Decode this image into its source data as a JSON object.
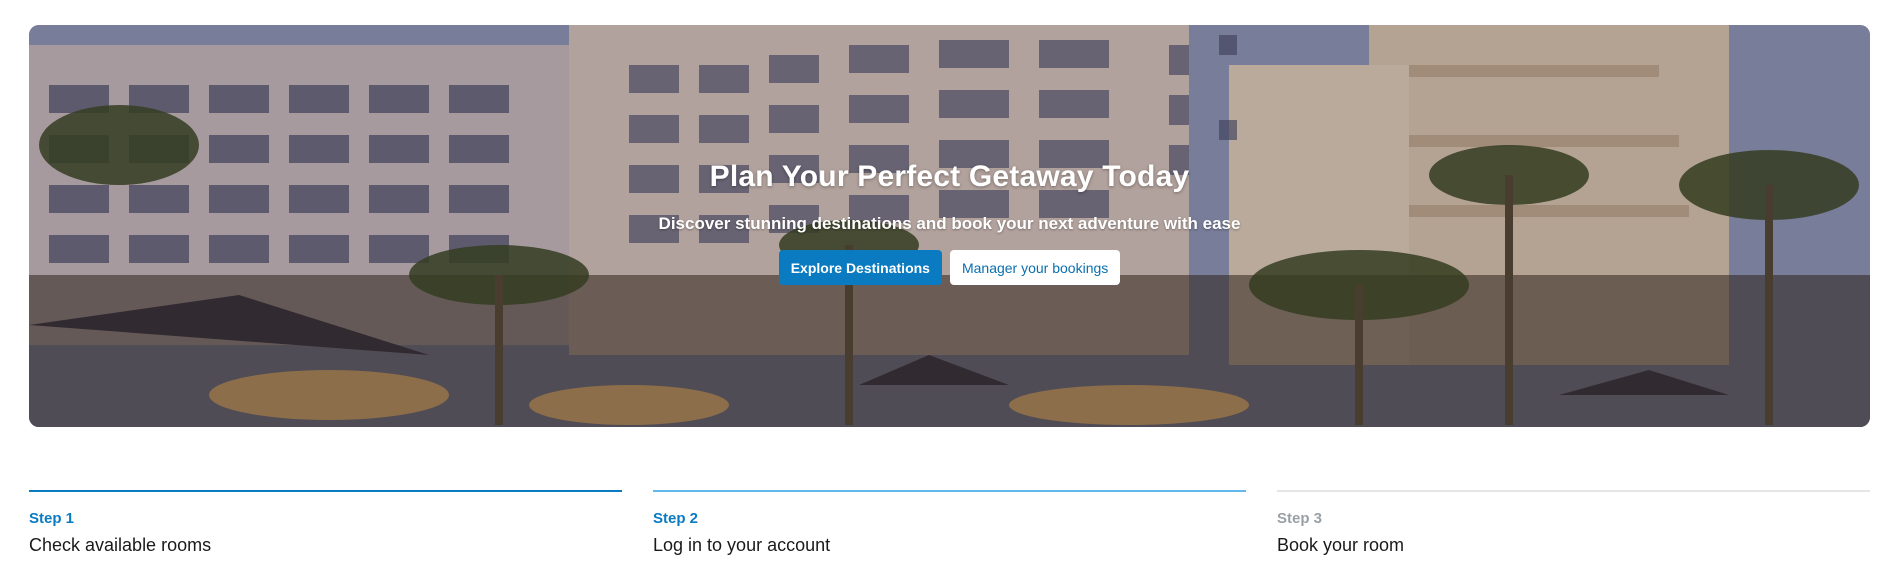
{
  "hero": {
    "title": "Plan Your Perfect Getaway Today",
    "subtitle": "Discover stunning destinations and book your next adventure with ease",
    "primary_button": "Explore Destinations",
    "secondary_button": "Manager your bookings",
    "image": "hotel-resort-photo"
  },
  "steps": [
    {
      "label": "Step 1",
      "title": "Check available rooms",
      "state": "done"
    },
    {
      "label": "Step 2",
      "title": "Log in to your account",
      "state": "active"
    },
    {
      "label": "Step 3",
      "title": "Book your room",
      "state": "pending"
    }
  ],
  "colors": {
    "accent": "#0a7bc1",
    "accent_light": "#63b9ee",
    "inactive": "#9aa0a6"
  }
}
